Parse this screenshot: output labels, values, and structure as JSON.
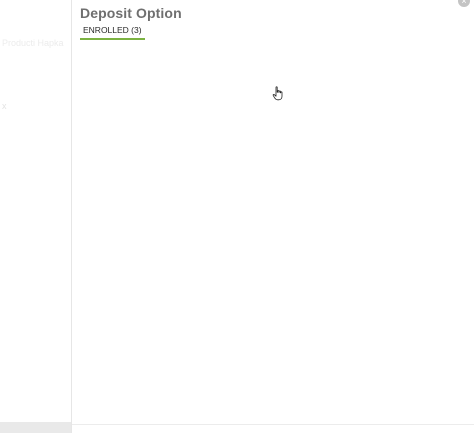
{
  "left_pane": {
    "faded_text": "Producti Hapka",
    "faded_mark": "x"
  },
  "drawer": {
    "title": "Deposit Option",
    "close_glyph": "×",
    "tabs": [
      {
        "label": "ENROLLED (3)",
        "active": true
      }
    ]
  },
  "colors": {
    "title": "#6f6f6f",
    "tab_underline": "#7cb342",
    "close_button": "#c4c4c4"
  },
  "icons": {
    "close": "close-icon",
    "cursor": "hand-pointer-cursor-icon"
  }
}
